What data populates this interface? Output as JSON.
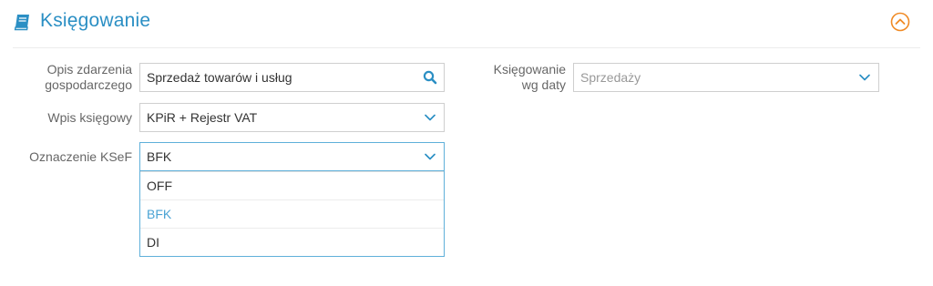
{
  "section": {
    "title": "Księgowanie"
  },
  "form": {
    "description": {
      "label_line1": "Opis zdarzenia",
      "label_line2": "gospodarczego",
      "value": "Sprzedaż towarów i usług"
    },
    "entry": {
      "label": "Wpis księgowy",
      "value": "KPiR + Rejestr VAT"
    },
    "ksef": {
      "label": "Oznaczenie KSeF",
      "value": "BFK",
      "options": [
        "OFF",
        "BFK",
        "DI"
      ],
      "selected_index": 1
    },
    "by_date": {
      "label_line1": "Księgowanie",
      "label_line2": "wg daty",
      "value": "Sprzedaży"
    }
  },
  "colors": {
    "accent_blue": "#2b8fc4",
    "accent_orange": "#f08a24"
  }
}
